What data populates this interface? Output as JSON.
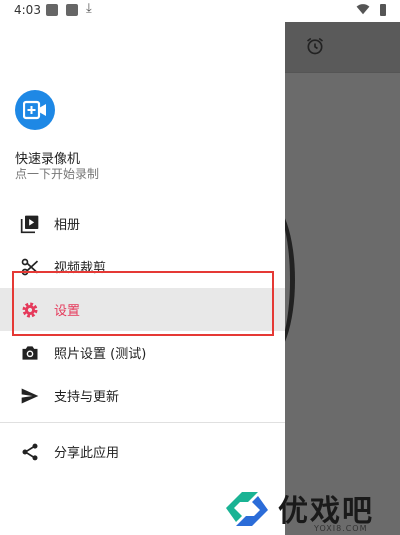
{
  "status_bar": {
    "time": "4:03"
  },
  "drawer": {
    "app_name": "快速录像机",
    "subtitle": "点一下开始录制",
    "menu": [
      {
        "id": "album",
        "label": "相册",
        "icon": "video-library-icon"
      },
      {
        "id": "video-trim",
        "label": "视频裁剪",
        "icon": "scissors-icon"
      },
      {
        "id": "settings",
        "label": "设置",
        "icon": "gear-icon",
        "selected": true
      },
      {
        "id": "photo-settings",
        "label": "照片设置 (测试)",
        "icon": "camera-icon"
      },
      {
        "id": "support",
        "label": "支持与更新",
        "icon": "send-icon"
      }
    ],
    "share": {
      "label": "分享此应用",
      "icon": "share-icon"
    }
  },
  "colors": {
    "accent": "#e53a5b",
    "logo": "#1e88e5",
    "highlight": "#e53935",
    "scrim": "#6b6b6b"
  },
  "watermark": {
    "text": "优戏吧",
    "domain": "YOXI8.COM"
  }
}
